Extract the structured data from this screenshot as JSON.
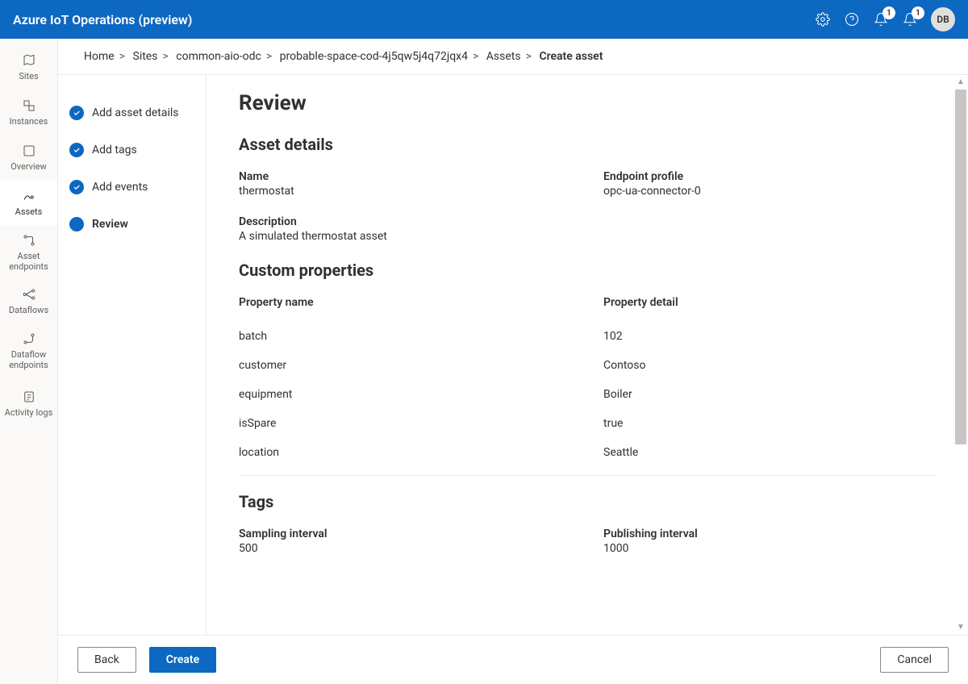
{
  "header": {
    "title": "Azure IoT Operations (preview)",
    "notification_count_1": "1",
    "notification_count_2": "1",
    "avatar_initials": "DB"
  },
  "nav": {
    "items": [
      {
        "label": "Sites"
      },
      {
        "label": "Instances"
      },
      {
        "label": "Overview"
      },
      {
        "label": "Assets"
      },
      {
        "label": "Asset endpoints"
      },
      {
        "label": "Dataflows"
      },
      {
        "label": "Dataflow endpoints"
      },
      {
        "label": "Activity logs"
      }
    ]
  },
  "breadcrumb": {
    "items": [
      "Home",
      "Sites",
      "common-aio-odc",
      "probable-space-cod-4j5qw5j4q72jqx4",
      "Assets",
      "Create asset"
    ]
  },
  "steps": [
    {
      "label": "Add asset details",
      "state": "done"
    },
    {
      "label": "Add tags",
      "state": "done"
    },
    {
      "label": "Add events",
      "state": "done"
    },
    {
      "label": "Review",
      "state": "current"
    }
  ],
  "review": {
    "page_title": "Review",
    "sections": {
      "asset_details": {
        "heading": "Asset details",
        "name_label": "Name",
        "name_value": "thermostat",
        "endpoint_label": "Endpoint profile",
        "endpoint_value": "opc-ua-connector-0",
        "description_label": "Description",
        "description_value": "A simulated thermostat asset"
      },
      "custom_properties": {
        "heading": "Custom properties",
        "col1": "Property name",
        "col2": "Property detail",
        "rows": [
          {
            "name": "batch",
            "detail": "102"
          },
          {
            "name": "customer",
            "detail": "Contoso"
          },
          {
            "name": "equipment",
            "detail": "Boiler"
          },
          {
            "name": "isSpare",
            "detail": "true"
          },
          {
            "name": "location",
            "detail": "Seattle"
          }
        ]
      },
      "tags": {
        "heading": "Tags",
        "sampling_label": "Sampling interval",
        "sampling_value": "500",
        "publishing_label": "Publishing interval",
        "publishing_value": "1000"
      }
    }
  },
  "footer": {
    "back": "Back",
    "create": "Create",
    "cancel": "Cancel"
  }
}
